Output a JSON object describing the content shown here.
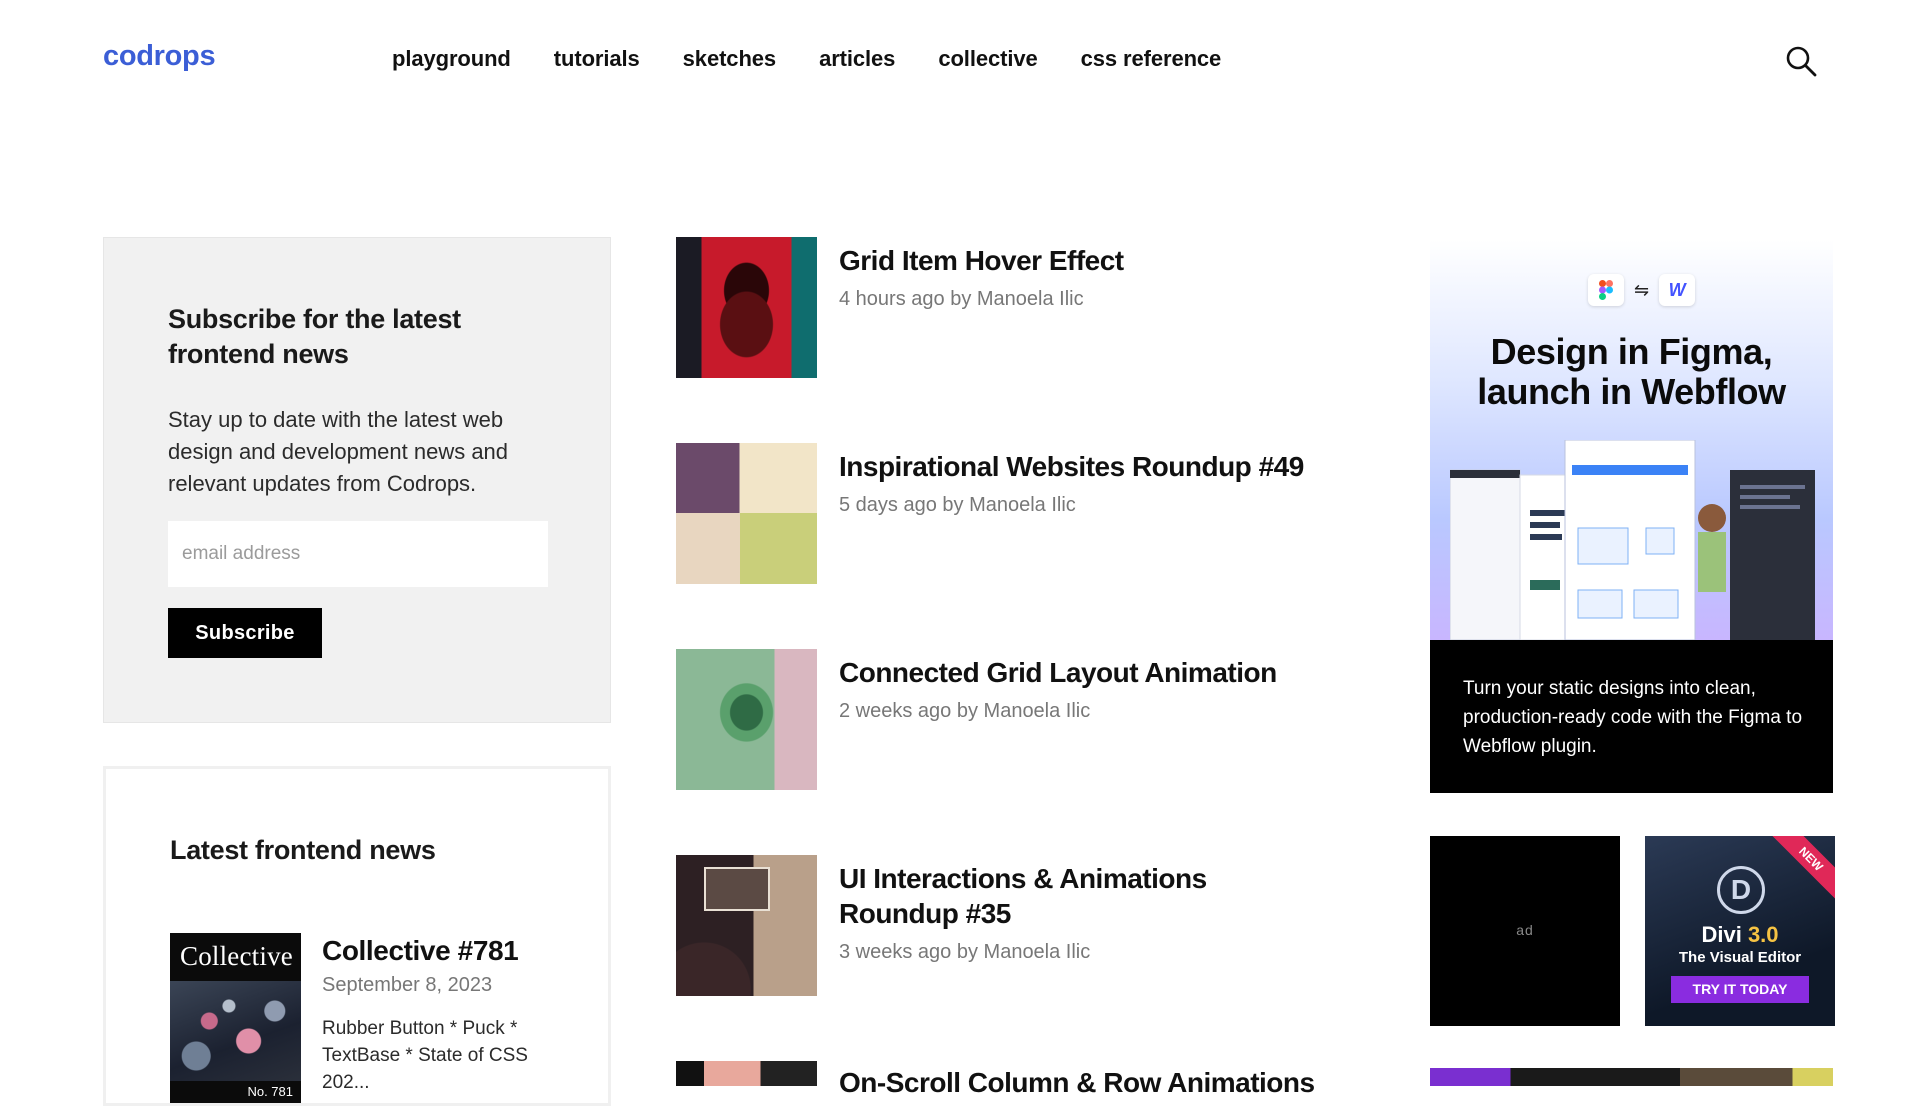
{
  "header": {
    "logo": "codrops",
    "nav": [
      "playground",
      "tutorials",
      "sketches",
      "articles",
      "collective",
      "css reference"
    ],
    "search_icon": "search-icon"
  },
  "subscribe": {
    "title": "Subscribe for the latest frontend news",
    "text": "Stay up to date with the latest web design and development news and relevant updates from Codrops.",
    "email_placeholder": "email address",
    "button_label": "Subscribe"
  },
  "latest_news": {
    "title": "Latest frontend news",
    "item": {
      "thumb_title": "Collective",
      "thumb_number": "No. 781",
      "title": "Collective #781",
      "date": "September 8, 2023",
      "description": "Rubber Button * Puck * TextBase * State of CSS 202..."
    }
  },
  "articles": [
    {
      "title": "Grid Item Hover Effect",
      "meta": "4 hours ago by Manoela Ilic"
    },
    {
      "title": "Inspirational Websites Roundup #49",
      "meta": "5 days ago by Manoela Ilic"
    },
    {
      "title": "Connected Grid Layout Animation",
      "meta": "2 weeks ago by Manoela Ilic"
    },
    {
      "title": "UI Interactions & Animations Roundup #35",
      "meta": "3 weeks ago by Manoela Ilic"
    },
    {
      "title": "On-Scroll Column & Row Animations",
      "meta": ""
    }
  ],
  "sidebar_ad": {
    "headline": "Design in Figma, launch in Webflow",
    "body": "Turn your static designs into clean, production-ready code with the Figma to Webflow plugin.",
    "logo_w": "W",
    "logo_arrows": "⇋"
  },
  "small_ads": {
    "placeholder": "ad",
    "divi": {
      "logo": "D",
      "name_prefix": "Divi ",
      "version": "3.0",
      "subtitle": "The Visual Editor",
      "cta": "TRY IT TODAY",
      "ribbon": "NEW"
    }
  },
  "colors": {
    "brand": "#3b5ed6",
    "panel": "#f1f1f1",
    "meta_text": "#777777",
    "button": "#000000"
  }
}
